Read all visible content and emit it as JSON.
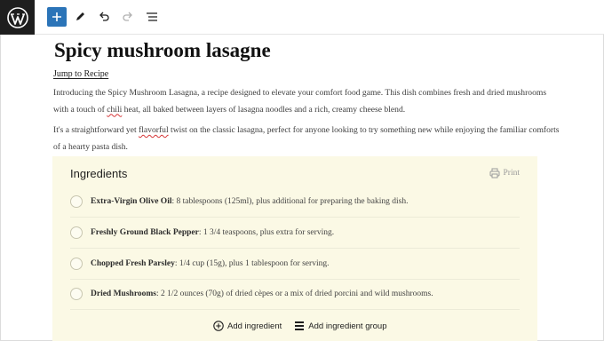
{
  "toolbar": {
    "logo_icon": "wordpress-logo-icon",
    "add_icon": "plus-icon",
    "tools_icon": "pencil-icon",
    "undo_icon": "undo-icon",
    "redo_icon": "redo-icon",
    "outline_icon": "list-view-icon",
    "accent_color": "#2b74b8"
  },
  "post": {
    "title": "Spicy mushroom lasagne",
    "jump_link": "Jump to Recipe",
    "paragraphs": [
      "Introducing the Spicy Mushroom Lasagna, a recipe designed to elevate your comfort food game. This dish combines fresh and dried mushrooms with a touch of chili heat, all baked between layers of lasagna noodles and a rich, creamy cheese blend.",
      "It's a straightforward yet flavorful twist on the classic lasagna, perfect for anyone looking to try something new while enjoying the familiar comforts of a hearty pasta dish."
    ]
  },
  "ingredients": {
    "heading": "Ingredients",
    "print_label": "Print",
    "items": [
      {
        "name": "Extra-Virgin Olive Oil",
        "detail": ": 8 tablespoons (125ml), plus additional for preparing the baking dish."
      },
      {
        "name": "Freshly Ground Black Pepper",
        "detail": ": 1 3/4 teaspoons, plus extra for serving."
      },
      {
        "name": "Chopped Fresh Parsley",
        "detail": ": 1/4 cup (15g), plus 1 tablespoon for serving."
      },
      {
        "name": "Dried Mushrooms",
        "detail": ": 2 1/2 ounces (70g) of dried cèpes or a mix of dried porcini and wild mushrooms."
      }
    ],
    "add_ingredient": "Add ingredient",
    "add_group": "Add ingredient group",
    "card_color": "#fbf9e5"
  }
}
